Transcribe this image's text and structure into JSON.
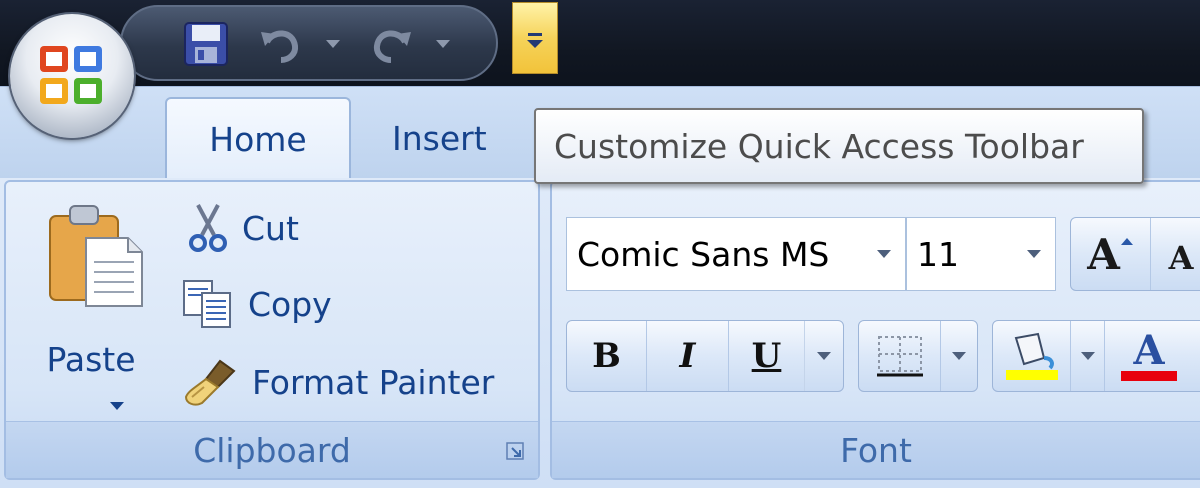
{
  "tabs": {
    "home": "Home",
    "insert": "Insert"
  },
  "tooltip": {
    "text": "Customize Quick Access Toolbar"
  },
  "clipboard": {
    "paste": "Paste",
    "cut": "Cut",
    "copy": "Copy",
    "format_painter": "Format Painter",
    "label": "Clipboard"
  },
  "font": {
    "family": "Comic Sans MS",
    "size": "11",
    "bold": "B",
    "italic": "I",
    "underline": "U",
    "grow_font": "A",
    "shrink_font": "A",
    "font_color_glyph": "A",
    "highlight_color": "#ffff00",
    "font_color": "#e8000d",
    "label": "Font"
  },
  "icons": {
    "office": "office-logo-icon",
    "save": "save-icon",
    "undo": "undo-icon",
    "redo": "redo-icon",
    "customize": "customize-qat-icon"
  }
}
